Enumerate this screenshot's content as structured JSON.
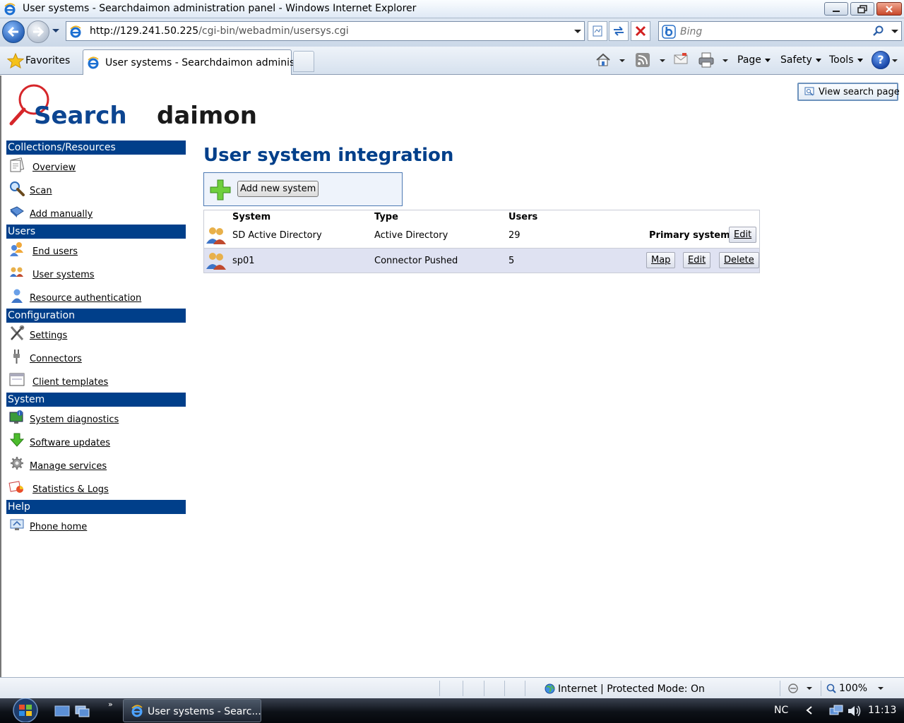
{
  "window": {
    "title": "User systems - Searchdaimon administration panel - Windows Internet Explorer"
  },
  "address_bar": {
    "url_host": "http://129.241.50.225",
    "url_path": "/cgi-bin/webadmin/usersys.cgi"
  },
  "search_bar": {
    "placeholder": "Bing"
  },
  "favorites": {
    "label": "Favorites"
  },
  "tab": {
    "label": "User systems - Searchdaimon adminis..."
  },
  "command_bar": {
    "page_label": "Page",
    "safety_label": "Safety",
    "tools_label": "Tools",
    "help_label": "?"
  },
  "header": {
    "logo_text_left": "Search",
    "logo_text_right": "daimon",
    "view_search_label": "View search page"
  },
  "sidebar": {
    "sections": [
      {
        "title": "Collections/Resources",
        "items": [
          {
            "label": "Overview",
            "icon": "overview-icon"
          },
          {
            "label": "Scan",
            "icon": "magnifier-icon"
          },
          {
            "label": "Add manually",
            "icon": "diamond-icon"
          }
        ]
      },
      {
        "title": "Users",
        "items": [
          {
            "label": "End users",
            "icon": "users-icon"
          },
          {
            "label": "User systems",
            "icon": "user-group-icon"
          },
          {
            "label": "Resource authentication",
            "icon": "person-icon"
          }
        ]
      },
      {
        "title": "Configuration",
        "items": [
          {
            "label": "Settings",
            "icon": "tools-icon"
          },
          {
            "label": "Connectors",
            "icon": "plug-icon"
          },
          {
            "label": "Client templates",
            "icon": "window-icon"
          }
        ]
      },
      {
        "title": "System",
        "items": [
          {
            "label": "System diagnostics",
            "icon": "monitor-icon"
          },
          {
            "label": "Software updates",
            "icon": "download-arrow-icon"
          },
          {
            "label": "Manage services",
            "icon": "gear-icon"
          },
          {
            "label": "Statistics & Logs",
            "icon": "chart-icon"
          }
        ]
      },
      {
        "title": "Help",
        "items": [
          {
            "label": "Phone home",
            "icon": "phone-home-icon"
          }
        ]
      }
    ]
  },
  "main": {
    "title": "User system integration",
    "add_button_label": "Add new system",
    "table": {
      "columns": [
        "System",
        "Type",
        "Users"
      ],
      "rows": [
        {
          "system": "SD Active Directory",
          "type": "Active Directory",
          "users": "29",
          "primary_label": "Primary system",
          "actions": [
            "Edit"
          ]
        },
        {
          "system": "sp01",
          "type": "Connector Pushed",
          "users": "5",
          "primary_label": "",
          "actions": [
            "Map",
            "Edit",
            "Delete"
          ]
        }
      ]
    }
  },
  "status_bar": {
    "zone": "Internet | Protected Mode: On",
    "zoom": "100%"
  },
  "taskbar": {
    "task_label": "User systems - Searc...",
    "language": "NC",
    "clock": "11:13"
  },
  "colors": {
    "sidebar_header": "#003f8a",
    "title": "#003f8a",
    "alt_row": "#dfe2f2"
  }
}
